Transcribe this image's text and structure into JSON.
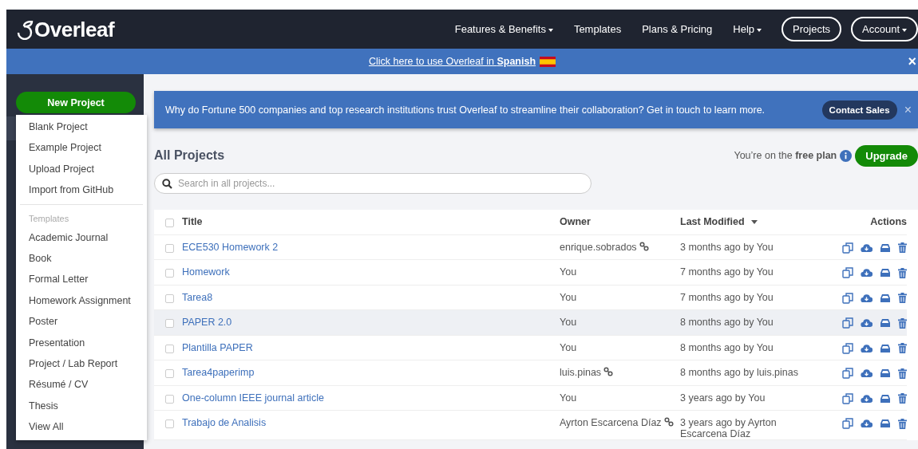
{
  "header": {
    "logo": "Overleaf",
    "nav": [
      {
        "label": "Features & Benefits",
        "kind": "link",
        "dropdown": true
      },
      {
        "label": "Templates",
        "kind": "link",
        "dropdown": false
      },
      {
        "label": "Plans & Pricing",
        "kind": "link",
        "dropdown": false
      },
      {
        "label": "Help",
        "kind": "link",
        "dropdown": true
      },
      {
        "label": "Projects",
        "kind": "pill",
        "dropdown": false
      },
      {
        "label": "Account",
        "kind": "pill",
        "dropdown": true
      }
    ]
  },
  "language_banner": {
    "link": "Click here to use Overleaf in **Spanish**",
    "close": "×"
  },
  "sidebar": {
    "new_project_button": "New Project",
    "menu": [
      {
        "kind": "item",
        "label": "Blank Project"
      },
      {
        "kind": "item",
        "label": "Example Project"
      },
      {
        "kind": "item",
        "label": "Upload Project"
      },
      {
        "kind": "item",
        "label": "Import from GitHub"
      },
      {
        "kind": "divider"
      },
      {
        "kind": "header",
        "label": "Templates"
      },
      {
        "kind": "item",
        "label": "Academic Journal"
      },
      {
        "kind": "item",
        "label": "Book"
      },
      {
        "kind": "item",
        "label": "Formal Letter"
      },
      {
        "kind": "item",
        "label": "Homework Assignment"
      },
      {
        "kind": "item",
        "label": "Poster"
      },
      {
        "kind": "item",
        "label": "Presentation"
      },
      {
        "kind": "item",
        "label": "Project / Lab Report"
      },
      {
        "kind": "item",
        "label": "Résumé / CV"
      },
      {
        "kind": "item",
        "label": "Thesis"
      },
      {
        "kind": "item",
        "label": "View All"
      }
    ]
  },
  "promo": {
    "text": "Why do Fortune 500 companies and top research institutions trust Overleaf to streamline their collaboration? Get in touch to learn more.",
    "button": "Contact Sales",
    "close": "×"
  },
  "title": "All Projects",
  "plan": {
    "text": "You’re on the **free plan**",
    "button": "Upgrade"
  },
  "search": {
    "placeholder": "Search in all projects..."
  },
  "table": {
    "all_checked": false,
    "columns": [
      {
        "label": "Title",
        "sorted": false
      },
      {
        "label": "Owner",
        "sorted": false
      },
      {
        "label": "Last Modified",
        "sorted": true
      },
      {
        "label": "Actions",
        "sorted": false
      }
    ],
    "rows": [
      {
        "title": "ECE530 Homework 2",
        "owner": "enrique.sobrados",
        "shared": true,
        "modified": "3 months ago by You",
        "hovered": false,
        "checked": false
      },
      {
        "title": "Homework",
        "owner": "You",
        "shared": false,
        "modified": "7 months ago by You",
        "hovered": false,
        "checked": false
      },
      {
        "title": "Tarea8",
        "owner": "You",
        "shared": false,
        "modified": "7 months ago by You",
        "hovered": false,
        "checked": false
      },
      {
        "title": "PAPER 2.0",
        "owner": "You",
        "shared": false,
        "modified": "8 months ago by You",
        "hovered": true,
        "checked": false
      },
      {
        "title": "Plantilla PAPER",
        "owner": "You",
        "shared": false,
        "modified": "8 months ago by You",
        "hovered": false,
        "checked": false
      },
      {
        "title": "Tarea4paperimp",
        "owner": "luis.pinas",
        "shared": true,
        "modified": "8 months ago by luis.pinas",
        "hovered": false,
        "checked": false
      },
      {
        "title": "One-column IEEE journal article",
        "owner": "You",
        "shared": false,
        "modified": "3 years ago by You",
        "hovered": false,
        "checked": false
      },
      {
        "title": "Trabajo de Analisis",
        "owner": "Ayrton Escarcena Díaz",
        "shared": true,
        "modified": "3 years ago by Ayrton Escarcena Díaz",
        "hovered": false,
        "checked": false
      }
    ]
  }
}
